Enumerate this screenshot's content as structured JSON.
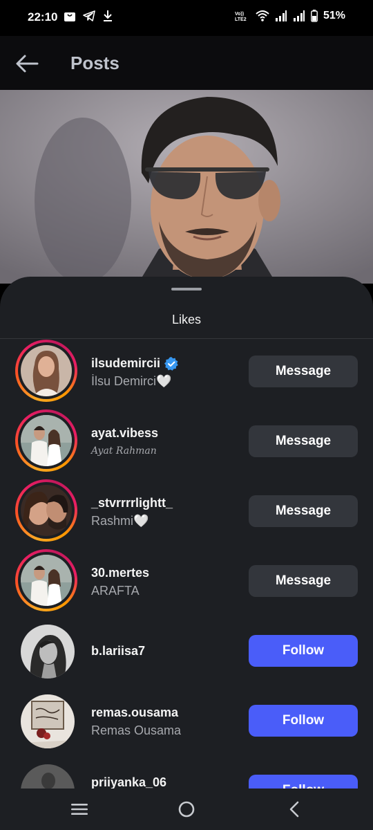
{
  "status_bar": {
    "time": "22:10",
    "battery": "51%",
    "icons": [
      "bag-notification-icon",
      "telegram-icon",
      "download-icon",
      "volte-icon",
      "wifi-icon",
      "signal-icon",
      "signal-icon",
      "battery-icon"
    ]
  },
  "app_bar": {
    "title": "Posts",
    "back_icon": "arrow-left-icon"
  },
  "sheet": {
    "title": "Likes"
  },
  "likes": [
    {
      "username": "ilsudemircii",
      "full_name": "İlsu Demirci🤍",
      "verified": true,
      "button": "Message",
      "story_ring": true
    },
    {
      "username": "ayat.vibess",
      "full_name": "Ayat Rahman",
      "verified": false,
      "button": "Message",
      "story_ring": true
    },
    {
      "username": "_stvrrrrlightt_",
      "full_name": "Rashmi🤍",
      "verified": false,
      "button": "Message",
      "story_ring": true
    },
    {
      "username": "30.mertes",
      "full_name": "ARAFTA",
      "verified": false,
      "button": "Message",
      "story_ring": true
    },
    {
      "username": "b.lariisa7",
      "full_name": "",
      "verified": false,
      "button": "Follow",
      "story_ring": false
    },
    {
      "username": "remas.ousama",
      "full_name": "Remas Ousama",
      "verified": false,
      "button": "Follow",
      "story_ring": false
    },
    {
      "username": "priiyanka_06",
      "full_name": "",
      "verified": false,
      "button": "Follow",
      "story_ring": false
    }
  ],
  "colors": {
    "follow_button": "#4a5df9",
    "message_button": "#33363c",
    "sheet_bg": "#1d1f23",
    "verified": "#3797f0"
  },
  "nav_bar": {
    "icons": [
      "recents-icon",
      "home-icon",
      "back-icon"
    ]
  }
}
